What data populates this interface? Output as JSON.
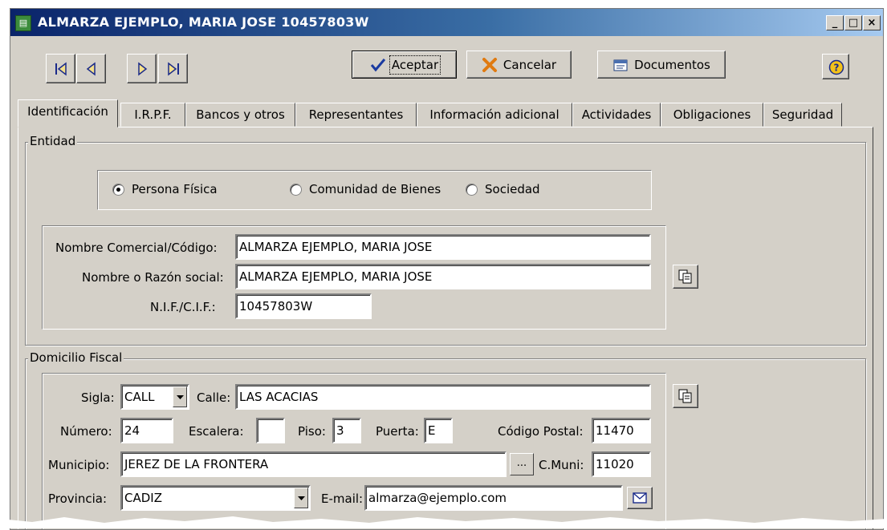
{
  "window": {
    "title": "ALMARZA EJEMPLO, MARIA JOSE  10457803W",
    "controls": {
      "minimize": "_",
      "maximize": "□",
      "close": "×"
    }
  },
  "toolbar": {
    "nav_icons": [
      "first-record-icon",
      "previous-record-icon",
      "next-record-icon",
      "last-record-icon"
    ],
    "accept_label": "Aceptar",
    "cancel_label": "Cancelar",
    "documents_label": "Documentos",
    "help_icon": "help-icon"
  },
  "tabs": [
    {
      "label": "Identificación",
      "active": true
    },
    {
      "label": "I.R.P.F."
    },
    {
      "label": "Bancos y otros"
    },
    {
      "label": "Representantes"
    },
    {
      "label": "Información adicional"
    },
    {
      "label": "Actividades"
    },
    {
      "label": "Obligaciones"
    },
    {
      "label": "Seguridad"
    }
  ],
  "entidad": {
    "legend": "Entidad",
    "radios": [
      {
        "label": "Persona Física",
        "selected": true
      },
      {
        "label": "Comunidad de Bienes",
        "selected": false
      },
      {
        "label": "Sociedad",
        "selected": false
      }
    ],
    "nombre_comercial_label": "Nombre Comercial/Código:",
    "nombre_comercial_value": "ALMARZA EJEMPLO, MARIA JOSE",
    "razon_social_label": "Nombre o Razón social:",
    "razon_social_value": "ALMARZA EJEMPLO, MARIA JOSE",
    "nif_label": "N.I.F./C.I.F.:",
    "nif_value": "10457803W",
    "copy_icon": "copy-icon"
  },
  "domicilio": {
    "legend": "Domicilio Fiscal",
    "sigla_label": "Sigla:",
    "sigla_value": "CALL",
    "calle_label": "Calle:",
    "calle_value": "LAS ACACIAS",
    "numero_label": "Número:",
    "numero_value": "24",
    "escalera_label": "Escalera:",
    "escalera_value": "",
    "piso_label": "Piso:",
    "piso_value": "3",
    "puerta_label": "Puerta:",
    "puerta_value": "E",
    "cp_label": "Código Postal:",
    "cp_value": "11470",
    "municipio_label": "Municipio:",
    "municipio_value": "JEREZ DE LA FRONTERA",
    "municipio_btn": "...",
    "cmuni_label": "C.Muni:",
    "cmuni_value": "11020",
    "provincia_label": "Provincia:",
    "provincia_value": "CADIZ",
    "email_label": "E-mail:",
    "email_value": "almarza@ejemplo.com",
    "copy_icon": "copy-icon",
    "mail_icon": "envelope-icon"
  }
}
